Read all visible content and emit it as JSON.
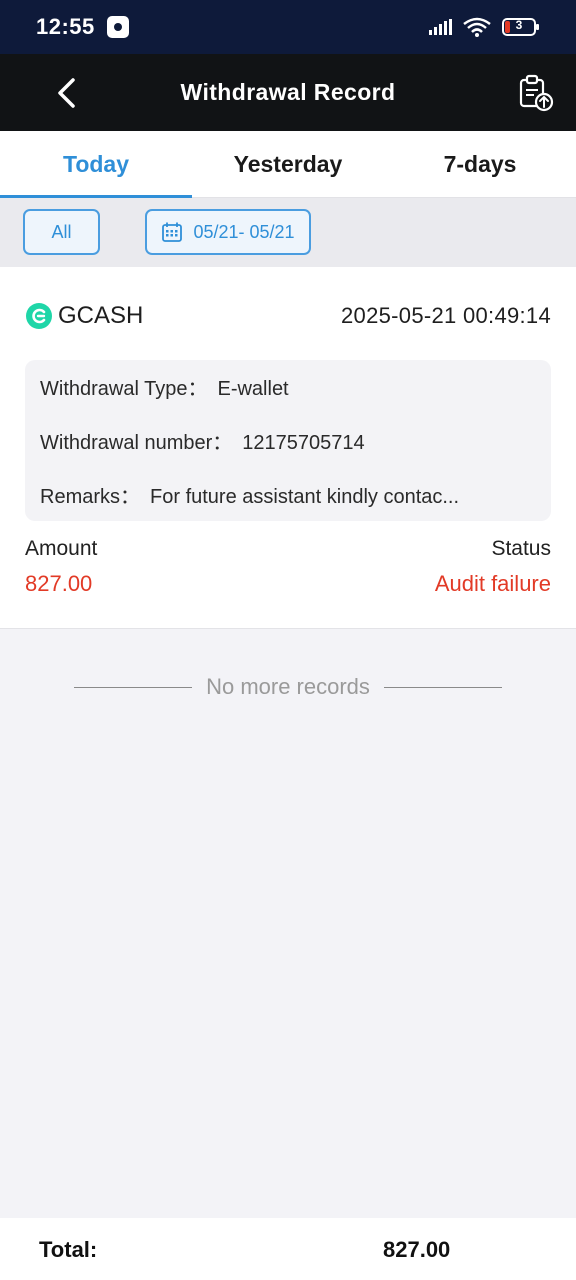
{
  "status_bar": {
    "time": "12:55",
    "battery_level": "3"
  },
  "header": {
    "title": "Withdrawal Record",
    "back_icon": "chevron-left-icon",
    "export_icon": "clipboard-upload-icon"
  },
  "tabs": [
    {
      "label": "Today",
      "active": true
    },
    {
      "label": "Yesterday",
      "active": false
    },
    {
      "label": "7-days",
      "active": false
    }
  ],
  "filters": {
    "type_label": "All",
    "date_range": "05/21- 05/21"
  },
  "record": {
    "method": "GCASH",
    "datetime": "2025-05-21 00:49:14",
    "type_label": "Withdrawal Type：",
    "type_value": "E-wallet",
    "number_label": "Withdrawal number：",
    "number_value": "12175705714",
    "remarks_label": "Remarks：",
    "remarks_value": "For future assistant kindly contac...",
    "amount_label": "Amount",
    "amount_value": "827.00",
    "status_label": "Status",
    "status_value": "Audit failure"
  },
  "list_end": "No more records",
  "footer": {
    "total_label": "Total:",
    "total_value": "827.00"
  },
  "colors": {
    "accent": "#2f8fd8",
    "error": "#e23a26",
    "gcash": "#1fd6a8",
    "header_bg": "#111315"
  }
}
